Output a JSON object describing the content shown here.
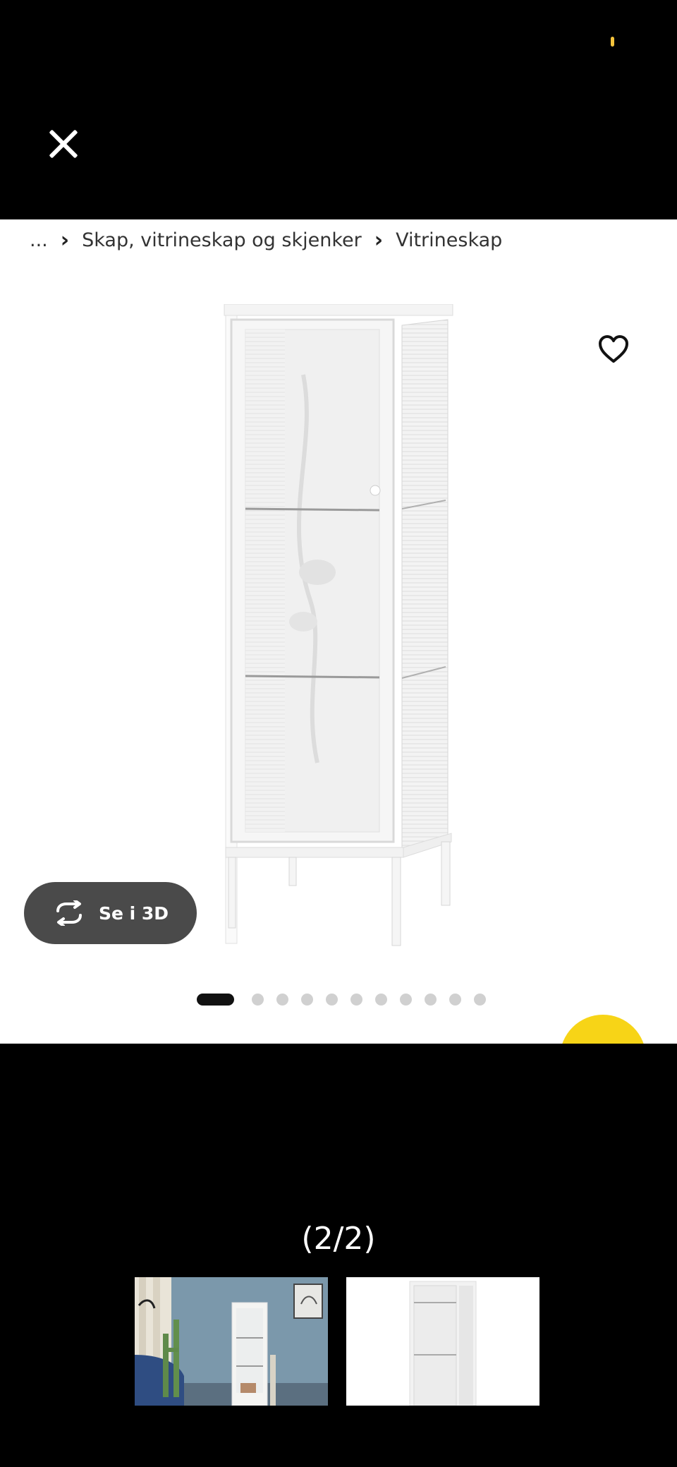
{
  "breadcrumb": {
    "ellipsis": "...",
    "items": [
      "Skap, vitrineskap og skjenker",
      "Vitrineskap"
    ]
  },
  "icons": {
    "close": "close-icon",
    "favorite": "heart-icon",
    "rotate": "rotate-3d-icon",
    "chevron": "chevron-right-icon"
  },
  "view3d": {
    "label": "Se i 3D"
  },
  "carousel": {
    "total": 11,
    "active_index": 1
  },
  "gallery": {
    "counter": "(2/2)"
  },
  "colors": {
    "accent_yellow": "#f7d417",
    "dark_button": "#4a4a4a",
    "status": "#f5c43c"
  }
}
